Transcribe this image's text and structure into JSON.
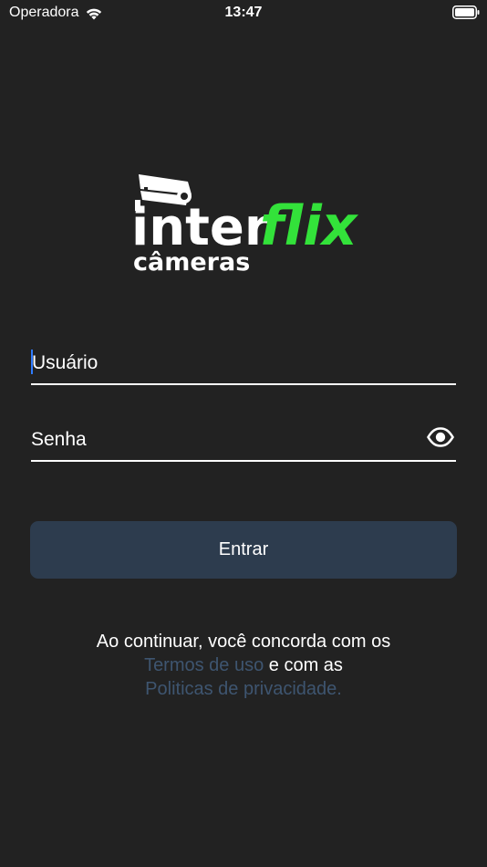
{
  "status_bar": {
    "carrier": "Operadora",
    "time": "13:47"
  },
  "logo": {
    "word_inter": "inter",
    "word_flix": "flix",
    "word_cameras": "câmeras",
    "accent_color": "#33e23a"
  },
  "form": {
    "username_placeholder": "Usuário",
    "password_placeholder": "Senha",
    "submit_label": "Entrar"
  },
  "terms": {
    "line1": "Ao continuar, você concorda com os",
    "terms_link": "Termos de uso",
    "and_text": " e com as",
    "privacy_link": "Politicas de privacidade."
  },
  "colors": {
    "background": "#222222",
    "button": "#2d3c4e",
    "link": "#3e5570",
    "caret": "#2f7bff"
  }
}
